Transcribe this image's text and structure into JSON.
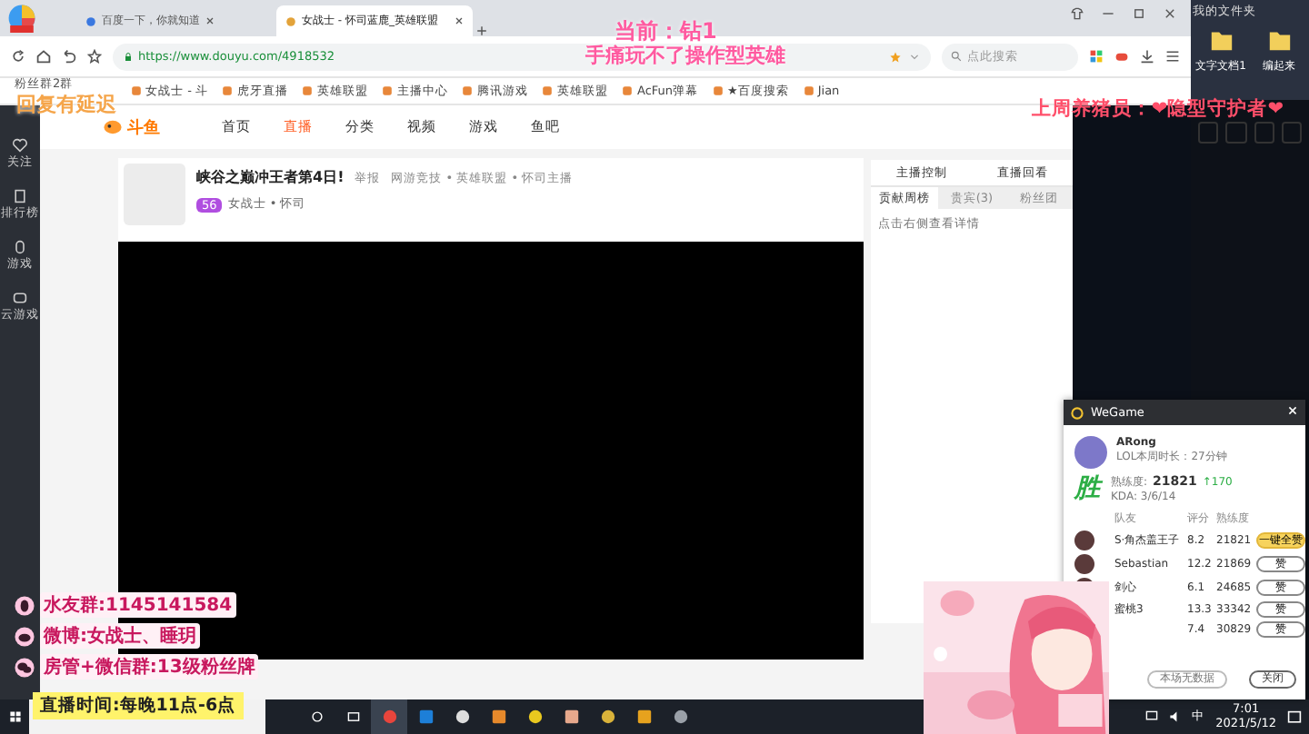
{
  "browser": {
    "tabs": [
      {
        "title": "百度一下，你就知道",
        "selected": false
      },
      {
        "title": "女战士 - 怀司蓝鹿_英雄联盟",
        "selected": true
      }
    ],
    "url": "https://www.douyu.com/4918532",
    "search": {
      "placeholder": "点此搜索"
    },
    "bookmarks": [
      "女战士 - 斗",
      "虎牙直播",
      "英雄联盟",
      "主播中心",
      "腾讯游戏",
      "英雄联盟",
      "AcFun弹幕",
      "★百度搜索",
      "Jian"
    ]
  },
  "site": {
    "logo": "斗鱼",
    "nav": [
      {
        "label": "首页",
        "selected": false
      },
      {
        "label": "直播",
        "selected": true
      },
      {
        "label": "分类",
        "selected": false
      },
      {
        "label": "视频",
        "selected": false
      },
      {
        "label": "游戏",
        "selected": false
      },
      {
        "label": "鱼吧",
        "selected": false
      }
    ],
    "sidebar": [
      "关注",
      "排行榜",
      "游戏",
      "云游戏"
    ],
    "room": {
      "title": "峡谷之巅冲王者第4日!",
      "report": "举报",
      "category": "网游竞技 • 英雄联盟 • 怀司主播",
      "level": "56",
      "anchor": "女战士 • 怀司"
    },
    "panel": {
      "header_tabs": [
        "主播控制",
        "直播回看"
      ],
      "tabs": [
        {
          "label": "贡献周榜",
          "selected": true
        },
        {
          "label": "贵宾(3)",
          "selected": false
        },
        {
          "label": "粉丝团",
          "selected": false
        }
      ],
      "hint": "点击右侧查看详情"
    }
  },
  "desktop": {
    "folder_title": "我的文件夹",
    "icons": [
      "文字文档1",
      "编起来"
    ]
  },
  "wegame": {
    "title": "WeGame",
    "name": "ARong",
    "playtime": "LOL本周时长：27分钟",
    "result": "胜",
    "proficiency_label": "熟练度:",
    "proficiency": "21821",
    "gain": "↑170",
    "kda": "KDA: 3/6/14",
    "columns": [
      "队友",
      "评分",
      "熟练度"
    ],
    "rows": [
      {
        "name": "S·角杰盖王子",
        "score": "8.2",
        "proficiency": "21821",
        "button": "一键全赞",
        "primary": true,
        "avatar": true
      },
      {
        "name": "Sebastian",
        "score": "12.2",
        "proficiency": "21869",
        "button": "赞",
        "primary": false,
        "avatar": true
      },
      {
        "name": "剑心",
        "score": "6.1",
        "proficiency": "24685",
        "button": "赞",
        "primary": false,
        "avatar": true
      },
      {
        "name": "蜜桃3",
        "score": "13.3",
        "proficiency": "33342",
        "button": "赞",
        "primary": false
      },
      {
        "score": "7.4",
        "proficiency": "30829",
        "button": "赞",
        "primary": false
      }
    ],
    "footer_buttons": [
      "本场无数据",
      "关闭"
    ]
  },
  "taskbar": {
    "ime": "中",
    "time": "7:01",
    "date": "2021/5/12"
  },
  "overlay": {
    "rank": "当前：钻1",
    "note": "手痛玩不了操作型英雄",
    "delay": "回复有延迟",
    "group_tag": "粉丝群2群",
    "top_fan": "上周养猪员：❤隐型守护者❤",
    "contacts": [
      {
        "kind": "qq",
        "text": "水友群:1145141584"
      },
      {
        "kind": "weibo",
        "text": "微博:女战士、睡玥"
      },
      {
        "kind": "wechat",
        "text": "房管+微信群:13级粉丝牌"
      }
    ],
    "schedule": "直播时间:每晚11点-6点"
  }
}
